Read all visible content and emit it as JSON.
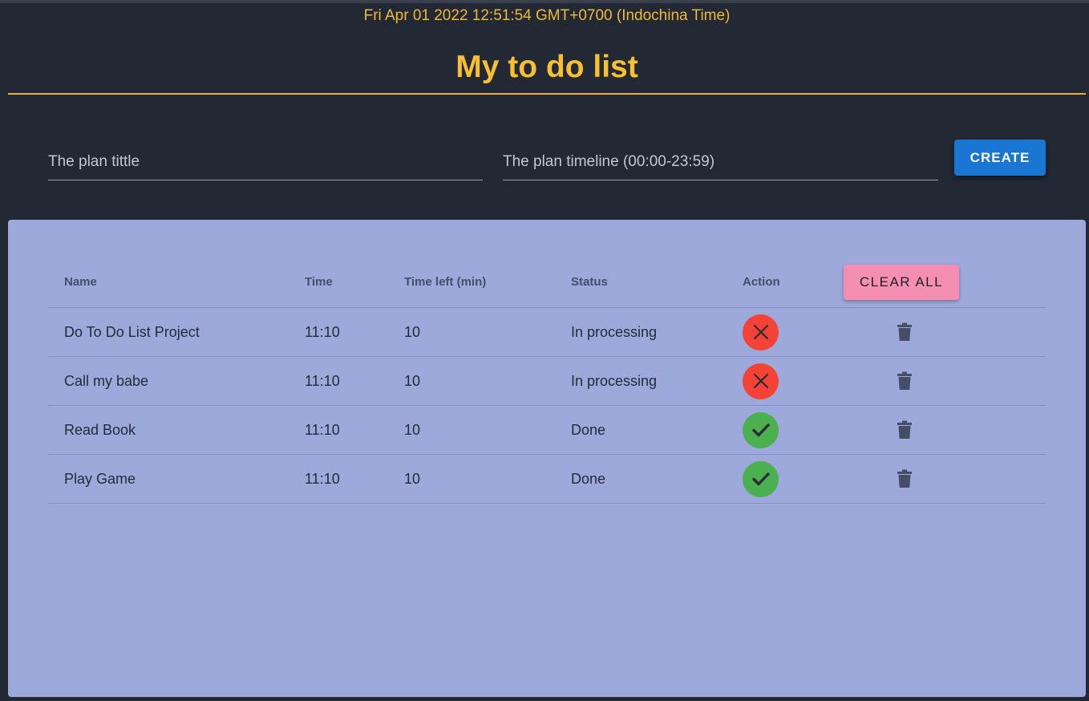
{
  "header": {
    "datetime": "Fri Apr 01 2022 12:51:54 GMT+0700 (Indochina Time)",
    "title": "My to do list"
  },
  "form": {
    "title_placeholder": "The plan tittle",
    "timeline_placeholder": "The plan timeline (00:00-23:59)",
    "create_label": "CREATE"
  },
  "table": {
    "columns": {
      "name": "Name",
      "time": "Time",
      "time_left": "Time left (min)",
      "status": "Status",
      "action": "Action"
    },
    "clear_all_label": "CLEAR ALL",
    "rows": [
      {
        "name": "Do To Do List Project",
        "time": "11:10",
        "time_left": "10",
        "status": "In processing",
        "action_icon": "close-icon"
      },
      {
        "name": "Call my babe",
        "time": "11:10",
        "time_left": "10",
        "status": "In processing",
        "action_icon": "close-icon"
      },
      {
        "name": "Read Book",
        "time": "11:10",
        "time_left": "10",
        "status": "Done",
        "action_icon": "check-icon"
      },
      {
        "name": "Play Game",
        "time": "11:10",
        "time_left": "10",
        "status": "Done",
        "action_icon": "check-icon"
      }
    ]
  },
  "colors": {
    "background": "#222834",
    "accent": "#f6bf34",
    "panel": "#9ea9db",
    "create_button": "#1976d2",
    "clear_button": "#f48fb1",
    "processing": "#f44336",
    "done": "#4caf50"
  }
}
